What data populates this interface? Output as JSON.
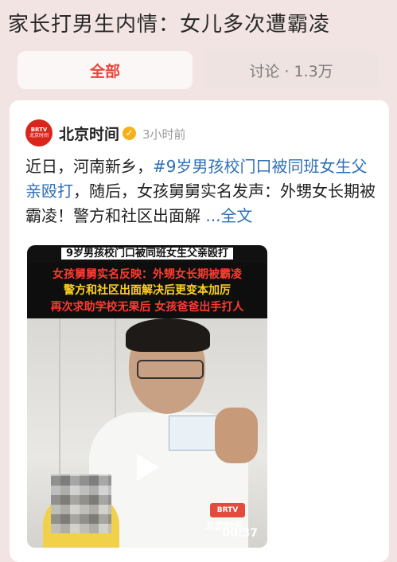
{
  "topic": {
    "title": "家长打男生内情：女儿多次遭霸凌"
  },
  "tabs": [
    {
      "label": "全部"
    },
    {
      "label": "讨论 · 1.3万"
    }
  ],
  "post": {
    "author": "北京时间",
    "verified_icon": "✓",
    "time": "3小时前",
    "text_prefix": "近日，河南新乡，",
    "hashtag": "#9岁男孩校门口被同班女生父亲殴打",
    "text_suffix": "，随后，女孩舅舅实名发声：外甥女长期被霸凌！警方和社区出面解",
    "more_label": "...全文",
    "avatar_line1": "BRTV",
    "avatar_line2": "北京时间"
  },
  "video": {
    "top_banner": "9岁男孩校门口被同班女生父亲殴打",
    "caption_line1": "女孩舅舅实名反映：外甥女长期被霸凌",
    "caption_line2": "警方和社区出面解决后更变本加厉",
    "caption_line3": "再次求助学校无果后 女孩爸爸出手打人",
    "watermark_logo": "BRTV",
    "watermark_text": "北京时间",
    "duration": "00:37"
  },
  "colors": {
    "accent": "#e8453c",
    "link": "#2f6fb8",
    "page_bg": "#f1e4e2"
  }
}
